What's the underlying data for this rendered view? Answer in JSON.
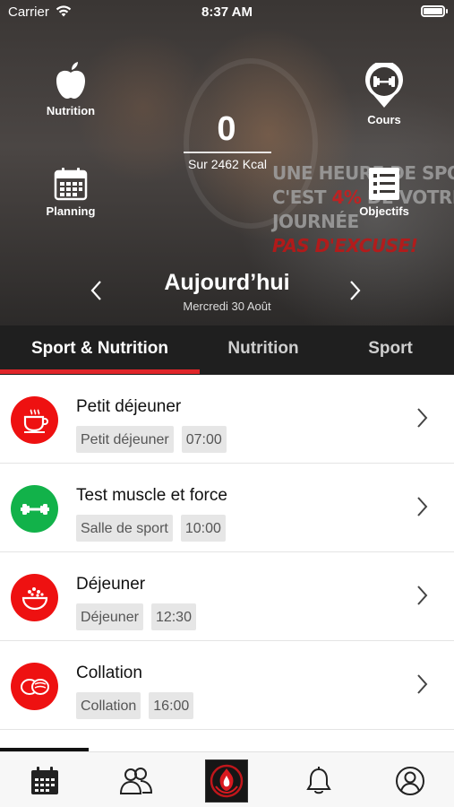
{
  "status_bar": {
    "carrier": "Carrier",
    "time": "8:37 AM"
  },
  "hero": {
    "nutrition_label": "Nutrition",
    "cours_label": "Cours",
    "planning_label": "Planning",
    "objectifs_label": "Objectifs",
    "kcal_value": "0",
    "kcal_label": "Sur 2462 Kcal",
    "poster": {
      "line1": "UNE HEURE DE SPORT",
      "line2_a": "C'EST ",
      "line2_hl": "4%",
      "line2_b": " DE VOTRE",
      "line3": "JOURNÉE",
      "line4": "PAS D'EXCUSE!"
    },
    "date_title": "Aujourd’hui",
    "date_sub": "Mercredi 30 Août"
  },
  "tabs": [
    "Sport & Nutrition",
    "Nutrition",
    "Sport"
  ],
  "rows": [
    {
      "title": "Petit déjeuner",
      "tag": "Petit déjeuner",
      "time": "07:00",
      "icon": "coffee-cup-icon",
      "color": "#ee1111"
    },
    {
      "title": "Test muscle et force",
      "tag": "Salle de sport",
      "time": "10:00",
      "icon": "dumbbell-icon",
      "color": "#12b24a"
    },
    {
      "title": "Déjeuner",
      "tag": "Déjeuner",
      "time": "12:30",
      "icon": "salad-bowl-icon",
      "color": "#ee1111"
    },
    {
      "title": "Collation",
      "tag": "Collation",
      "time": "16:00",
      "icon": "snack-icon",
      "color": "#ee1111"
    }
  ],
  "colors": {
    "accent": "#e0262a",
    "tab_bar": "#1f1f1f",
    "green": "#12b24a"
  },
  "bottom_nav": [
    "calendar-icon",
    "users-icon",
    "app-logo",
    "bell-icon",
    "profile-icon"
  ]
}
